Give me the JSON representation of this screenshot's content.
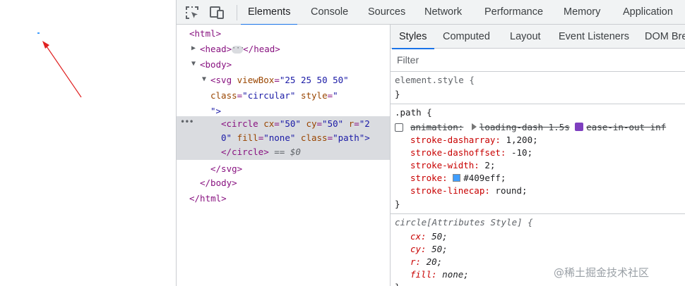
{
  "toolbar": {
    "inspect_icon": "element-picker-icon",
    "device_icon": "device-toolbar-icon",
    "tabs": [
      "Elements",
      "Console",
      "Sources",
      "Network",
      "Performance",
      "Memory",
      "Application"
    ],
    "active_tab": "Elements"
  },
  "dom_tree": {
    "html_open": "<html>",
    "head_open": "<head>",
    "head_close": "</head>",
    "body_open": "<body>",
    "svg_tag": "<svg",
    "svg_attr_viewbox_name": "viewBox",
    "svg_attr_viewbox_value": "\"25 25 50 50\"",
    "svg_attr_class_name": "class",
    "svg_attr_class_value": "\"circular\"",
    "svg_attr_style_name": "style",
    "svg_attr_style_value_open": "\"",
    "svg_attr_style_value_close": "\">",
    "circle_tag": "<circle",
    "circle_cx_name": "cx",
    "circle_cx_value": "\"50\"",
    "circle_cy_name": "cy",
    "circle_cy_value": "\"50\"",
    "circle_r_name": "r",
    "circle_r_value_part1": "\"2",
    "circle_r_value_part2": "0\"",
    "circle_fill_name": "fill",
    "circle_fill_value": "\"none\"",
    "circle_class_name": "class",
    "circle_class_value": "\"path\">",
    "circle_close": "</circle>",
    "selected_marker": "== $0",
    "svg_close": "</svg>",
    "body_close": "</body>",
    "html_close": "</html>"
  },
  "styles_panel": {
    "tabs": [
      "Styles",
      "Computed",
      "Layout",
      "Event Listeners",
      "DOM Bre"
    ],
    "active_tab": "Styles",
    "filter_placeholder": "Filter",
    "element_style_selector": "element.style {",
    "close_brace": "}",
    "path_rule": {
      "selector": ".path {",
      "animation_name": "animation:",
      "animation_value_1": "loading-dash 1.5s",
      "animation_value_2": "ease-in-out inf",
      "props": [
        {
          "name": "stroke-dasharray:",
          "value": " 1,200;"
        },
        {
          "name": "stroke-dashoffset:",
          "value": " -10;"
        },
        {
          "name": "stroke-width:",
          "value": " 2;"
        },
        {
          "name": "stroke:",
          "value": "#409eff;"
        },
        {
          "name": "stroke-linecap:",
          "value": " round;"
        }
      ],
      "stroke_color": "#409eff"
    },
    "attr_rule": {
      "selector": "circle[Attributes Style] {",
      "props": [
        {
          "name": "cx:",
          "value": " 50;"
        },
        {
          "name": "cy:",
          "value": " 50;"
        },
        {
          "name": "r:",
          "value": " 20;"
        },
        {
          "name": "fill:",
          "value": " none;"
        }
      ]
    }
  },
  "watermark": "@稀土掘金技术社区",
  "colors": {
    "accent": "#1a73e8",
    "arrow": "#e02020",
    "spinner": "#409eff"
  }
}
